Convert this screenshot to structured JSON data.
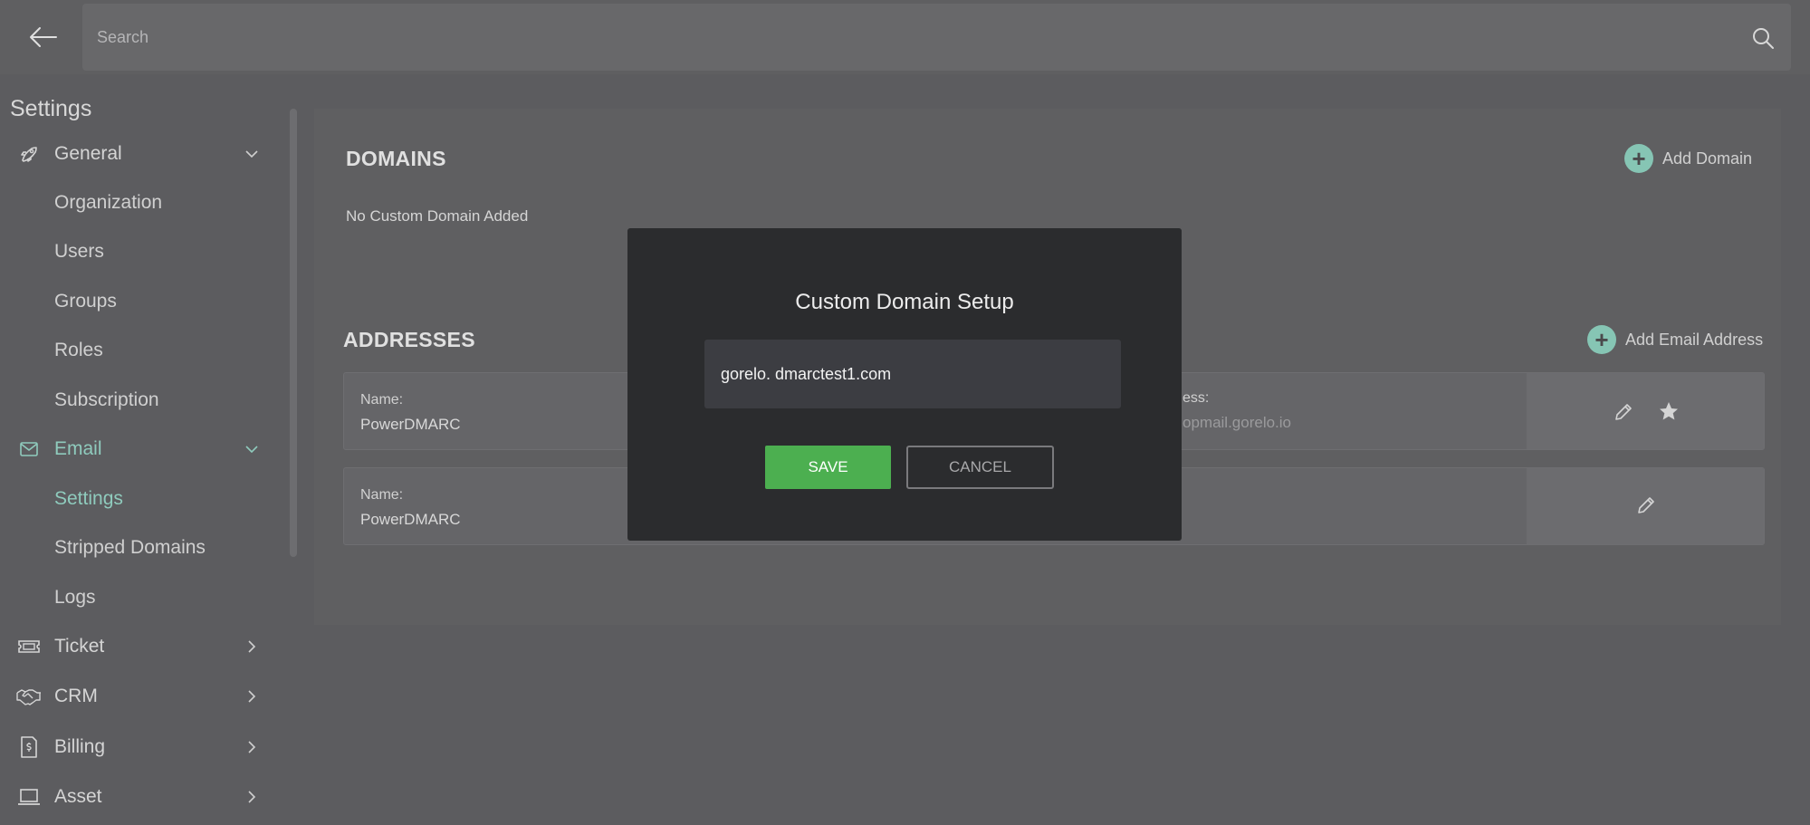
{
  "search": {
    "placeholder": "Search"
  },
  "sidebar": {
    "title": "Settings",
    "items": [
      {
        "label": "General",
        "icon": "rocket-icon"
      },
      {
        "label": "Organization"
      },
      {
        "label": "Users"
      },
      {
        "label": "Groups"
      },
      {
        "label": "Roles"
      },
      {
        "label": "Subscription"
      },
      {
        "label": "Email",
        "icon": "mail-icon"
      },
      {
        "label": "Settings"
      },
      {
        "label": "Stripped Domains"
      },
      {
        "label": "Logs"
      },
      {
        "label": "Ticket",
        "icon": "ticket-icon"
      },
      {
        "label": "CRM",
        "icon": "handshake-icon"
      },
      {
        "label": "Billing",
        "icon": "invoice-icon"
      },
      {
        "label": "Asset",
        "icon": "laptop-icon"
      }
    ]
  },
  "domains": {
    "title": "DOMAINS",
    "add_label": "Add Domain",
    "empty_text": "No Custom Domain Added"
  },
  "addresses": {
    "title": "ADDRESSES",
    "add_label": "Add Email Address",
    "rows": [
      {
        "name_label": "Name:",
        "name": "PowerDMARC",
        "address_label": "ess:",
        "address": "opmail.gorelo.io"
      },
      {
        "name_label": "Name:",
        "name": "PowerDMARC"
      }
    ]
  },
  "modal": {
    "title": "Custom Domain Setup",
    "input_value": "gorelo. dmarctest1.com",
    "save_label": "SAVE",
    "cancel_label": "CANCEL"
  },
  "colors": {
    "accent": "#8fcbbd",
    "save": "#4caf50",
    "modal_bg": "#2b2c2e"
  }
}
